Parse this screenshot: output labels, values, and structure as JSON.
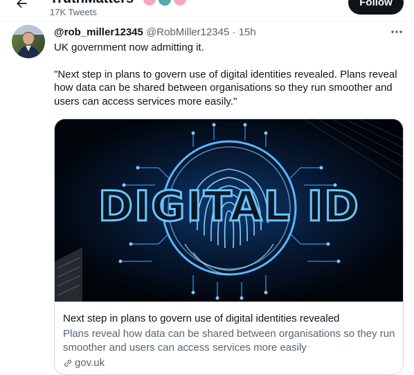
{
  "header": {
    "profile_name": "TruthMatters",
    "tweet_count": "17K Tweets",
    "follow_label": "Follow"
  },
  "tweet": {
    "display_name": "@rob_miller12345",
    "handle": "@RobMiller12345",
    "separator": "·",
    "time": "15h",
    "text_line1": "UK government now admitting it.",
    "text_quote": "\"Next step in plans to govern use of digital identities revealed. Plans reveal how data can be shared between organisations so they run smoother and users can access services more easily.\""
  },
  "card": {
    "image_text": "DIGITAL ID",
    "title": "Next step in plans to govern use of digital identities revealed",
    "description": "Plans reveal how data can be shared between organisations so they run smoother and users can access services more easily",
    "domain": "gov.uk"
  },
  "icons": {
    "back": "arrow-left-icon",
    "more": "more-horizontal-icon",
    "link": "link-icon",
    "avatar": "user-photo"
  },
  "colors": {
    "text_primary": "#0f1419",
    "text_secondary": "#536471",
    "border": "#cfd9de",
    "follow_bg": "#0f1419",
    "card_image_glow": "#3aa8ff"
  }
}
